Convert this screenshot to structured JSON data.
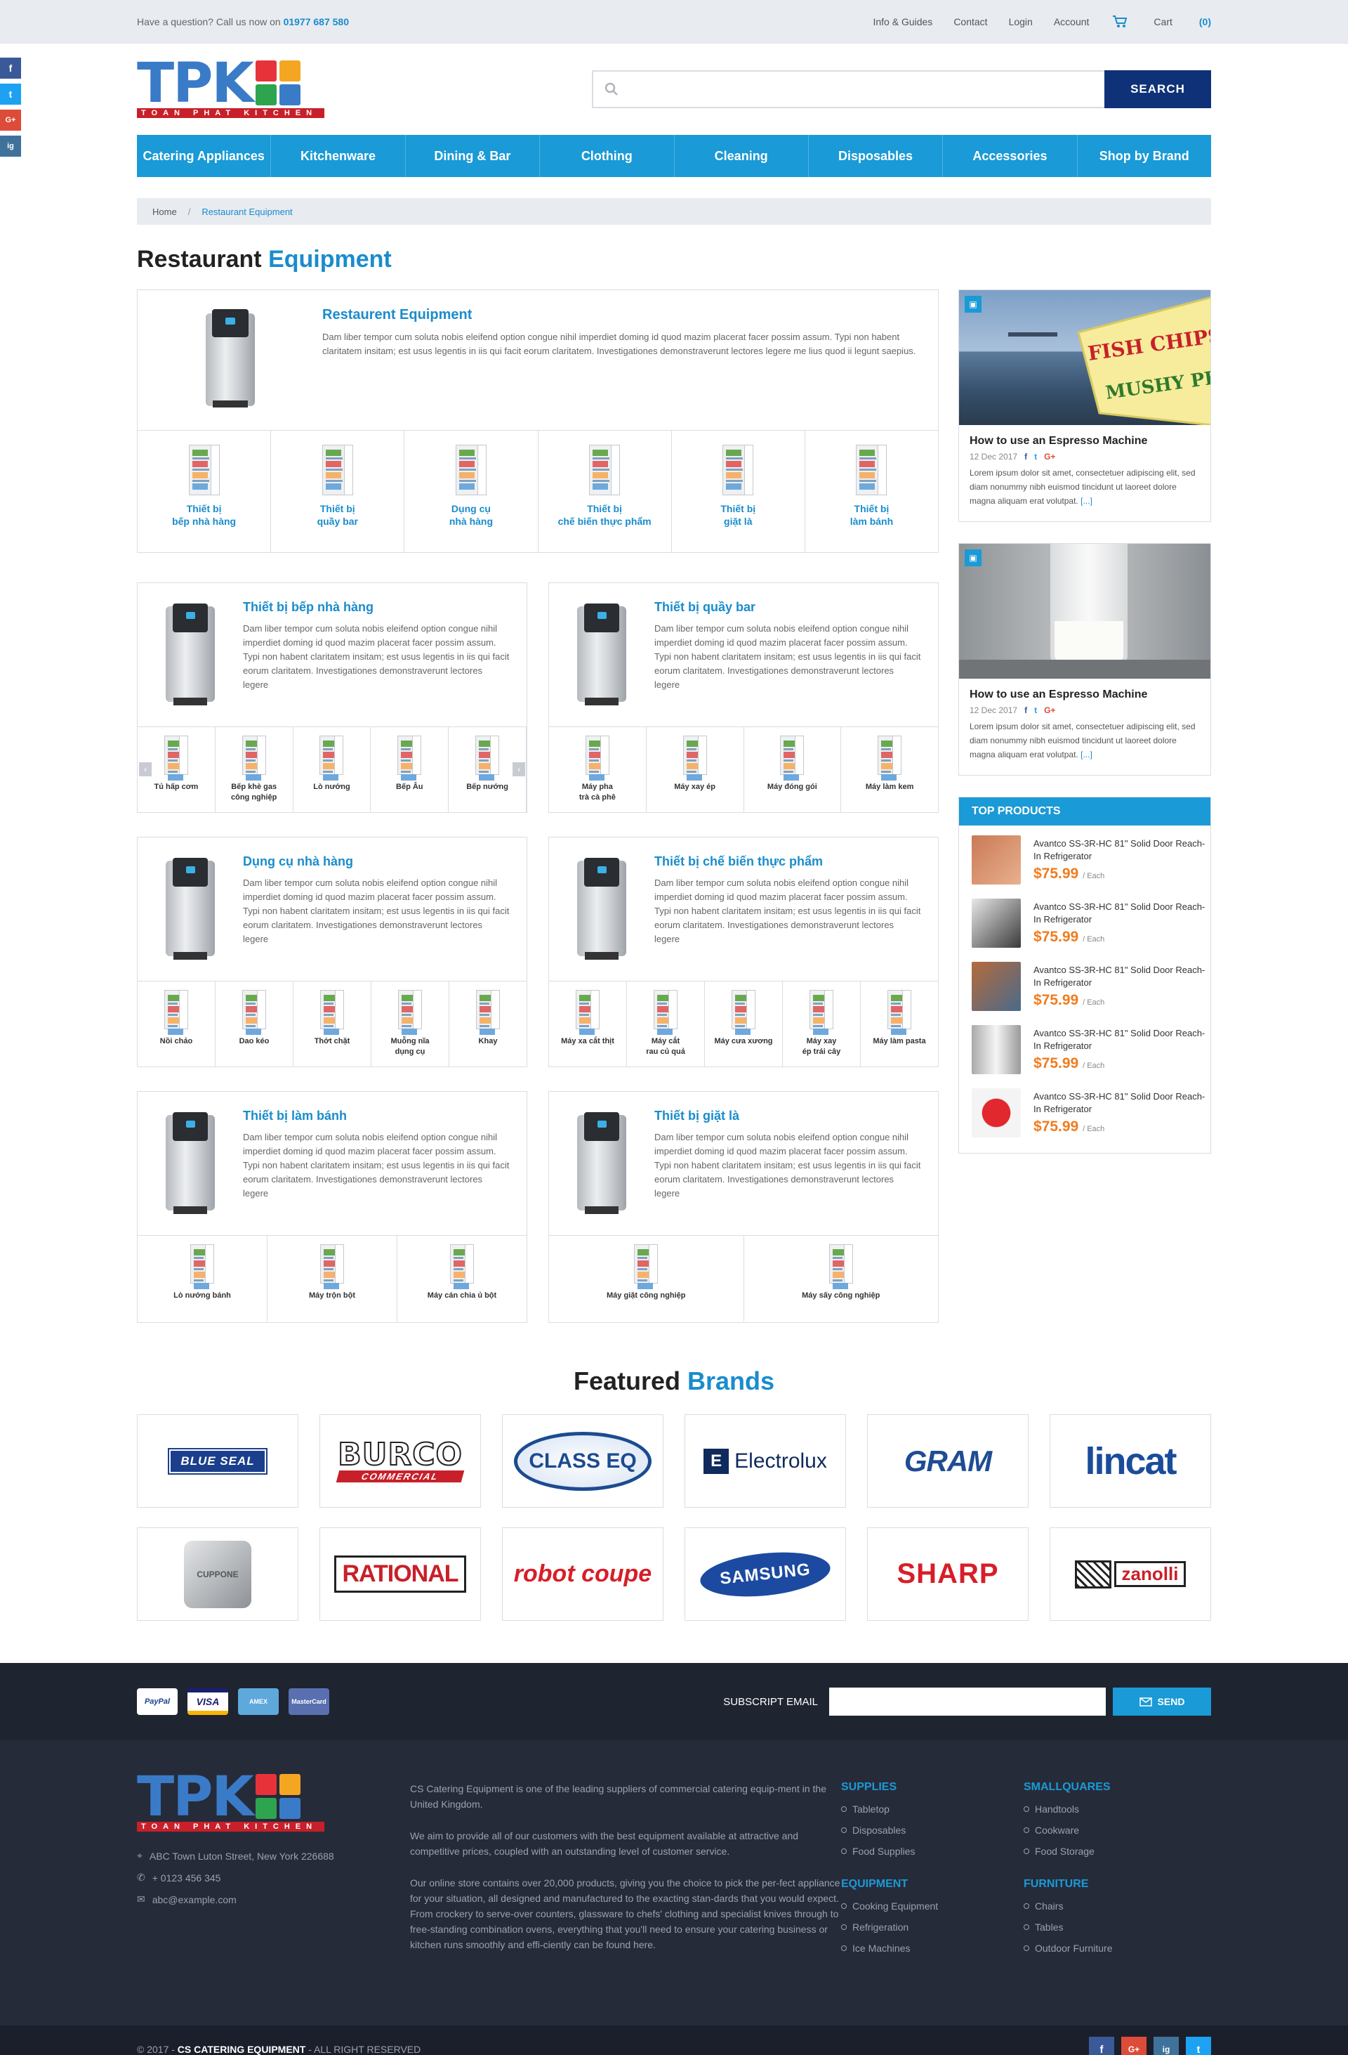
{
  "topbar": {
    "question": "Have a question? Call us now on",
    "phone": "01977 687 580",
    "links": [
      "Info & Guides",
      "Contact",
      "Login",
      "Account"
    ],
    "cart_label": "Cart",
    "cart_count": "(0)"
  },
  "social_side": [
    "f",
    "t",
    "G+",
    "ig"
  ],
  "logo": {
    "text": "TPK",
    "strip": "TOAN PHAT KITCHEN"
  },
  "search": {
    "placeholder": "",
    "button": "SEARCH"
  },
  "nav": [
    "Catering Appliances",
    "Kitchenware",
    "Dining & Bar",
    "Clothing",
    "Cleaning",
    "Disposables",
    "Accessories",
    "Shop by Brand"
  ],
  "breadcrumb": {
    "home": "Home",
    "sep": "/",
    "current": "Restaurant Equipment"
  },
  "page_title": {
    "a": "Restaurant",
    "b": "Equipment"
  },
  "featured": {
    "title": "Restaurent Equipment",
    "desc": "Dam liber tempor cum soluta nobis eleifend option congue nihil imperdiet doming id quod mazim placerat facer possim assum. Typi non habent claritatem insitam; est usus legentis in iis qui facit eorum claritatem. Investigationes demonstraverunt lectores legere me lius quod ii legunt saepius.",
    "cats": [
      "Thiết bị\nbếp nhà hàng",
      "Thiết bị\nquầy bar",
      "Dụng cụ\nnhà hàng",
      "Thiết bị\nchế biến thực phẩm",
      "Thiết bị\ngiặt là",
      "Thiết bị\nlàm bánh"
    ]
  },
  "desc_small": "Dam liber tempor cum soluta nobis eleifend option congue nihil imperdiet doming id quod mazim placerat facer possim assum. Typi non habent claritatem insitam; est usus legentis in iis qui facit eorum claritatem. Investigationes demonstraverunt lectores legere",
  "cards": [
    {
      "title": "Thiết bị bếp nhà hàng",
      "items": [
        "Tủ hấp cơm",
        "Bếp khè gas\ncông nghiệp",
        "Lò nướng",
        "Bếp Âu",
        "Bếp nướng"
      ]
    },
    {
      "title": "Thiết bị quầy bar",
      "items": [
        "Máy pha\ntrà cà phê",
        "Máy xay ép",
        "Máy đóng gói",
        "Máy làm kem"
      ]
    },
    {
      "title": "Dụng cụ nhà hàng",
      "items": [
        "Nồi chảo",
        "Dao kéo",
        "Thớt chặt",
        "Muỗng nĩa\ndụng cụ",
        "Khay"
      ]
    },
    {
      "title": "Thiết bị chế biến thực phẩm",
      "items": [
        "Máy xa cắt thịt",
        "Máy cắt\nrau củ quả",
        "Máy cưa xương",
        "Máy xay\nép trái cây",
        "Máy làm pasta"
      ]
    },
    {
      "title": "Thiết bị làm bánh",
      "items": [
        "Lò nướng bánh",
        "Máy trộn bột",
        "Máy cán chia ủ bột"
      ]
    },
    {
      "title": "Thiết bị giặt là",
      "items": [
        "Máy giặt công nghiệp",
        "Máy sấy công nghiệp"
      ]
    }
  ],
  "posts": [
    {
      "title": "How to use an Espresso Machine",
      "date": "12 Dec 2017",
      "text": "Lorem ipsum dolor sit amet, consectetuer adipiscing elit, sed diam nonummy nibh euismod tincidunt ut laoreet dolore magna aliquam erat volutpat.",
      "more": "[...]",
      "sign1": "FISH CHIPS",
      "sign2": "MUSHY PEAS"
    },
    {
      "title": "How to use an Espresso Machine",
      "date": "12 Dec 2017",
      "text": "Lorem ipsum dolor sit amet, consectetuer adipiscing elit, sed diam nonummy nibh euismod tincidunt ut laoreet dolore magna aliquam erat volutpat.",
      "more": "[...]"
    }
  ],
  "top_products": {
    "heading": "TOP PRODUCTS",
    "items": [
      {
        "name": "Avantco SS-3R-HC 81\" Solid Door Reach-In Refrigerator",
        "price": "$75.99",
        "unit": "/ Each"
      },
      {
        "name": "Avantco SS-3R-HC 81\" Solid Door Reach-In Refrigerator",
        "price": "$75.99",
        "unit": "/ Each"
      },
      {
        "name": "Avantco SS-3R-HC 81\" Solid Door Reach-In Refrigerator",
        "price": "$75.99",
        "unit": "/ Each"
      },
      {
        "name": "Avantco SS-3R-HC 81\" Solid Door Reach-In Refrigerator",
        "price": "$75.99",
        "unit": "/ Each"
      },
      {
        "name": "Avantco SS-3R-HC 81\" Solid Door Reach-In Refrigerator",
        "price": "$75.99",
        "unit": "/ Each"
      }
    ]
  },
  "brands_title": {
    "a": "Featured",
    "b": "Brands"
  },
  "brands": [
    "BLUE SEAL",
    "BURCO",
    "CLASS EQ",
    "Electrolux",
    "GRAM",
    "lincat",
    "CUPPONE",
    "RATIONAL",
    "robot coupe",
    "SAMSUNG",
    "SHARP",
    "zanolli"
  ],
  "brand_sub": {
    "burco": "COMMERCIAL"
  },
  "payment": [
    "PayPal",
    "VISA",
    "AMEX",
    "MasterCard"
  ],
  "subscribe": {
    "label": "SUBSCRIPT EMAIL",
    "button": "SEND"
  },
  "footer": {
    "address": "ABC Town Luton Street, New York 226688",
    "phone": "+ 0123 456 345",
    "email": "abc@example.com",
    "about": [
      "CS Catering Equipment is one of the leading suppliers of commercial catering equip-ment in the United Kingdom.",
      "We aim to provide all of our customers with the best equipment available at attractive and competitive prices, coupled with an outstanding level of customer service.",
      "Our online store contains over 20,000 products, giving you the choice to pick the per-fect appliance for your situation, all designed and manufactured to the exacting stan-dards that you would expect. From crockery to serve-over counters, glassware to chefs' clothing and specialist knives through to free-standing combination ovens, everything that you'll need to ensure your catering business or kitchen runs smoothly and effi-ciently can be found here."
    ],
    "col3": [
      {
        "head": "SUPPLIES",
        "links": [
          "Tabletop",
          "Disposables",
          "Food Supplies"
        ]
      },
      {
        "head": "EQUIPMENT",
        "links": [
          "Cooking Equipment",
          "Refrigeration",
          "Ice Machines"
        ]
      }
    ],
    "col4": [
      {
        "head": "SMALLQUARES",
        "links": [
          "Handtools",
          "Cookware",
          "Food Storage"
        ]
      },
      {
        "head": "FURNITURE",
        "links": [
          "Chairs",
          "Tables",
          "Outdoor Furniture"
        ]
      }
    ]
  },
  "copyright": {
    "pre": "© 2017 -",
    "brand": "CS CATERING EQUIPMENT",
    "post": "- ALL RIGHT RESERVED"
  },
  "bottom_social": [
    "f",
    "G+",
    "ig",
    "t"
  ],
  "colors": {
    "primary": "#1a9ad6",
    "navy": "#0f3177",
    "price": "#f07c1e",
    "footer": "#262b3a"
  }
}
